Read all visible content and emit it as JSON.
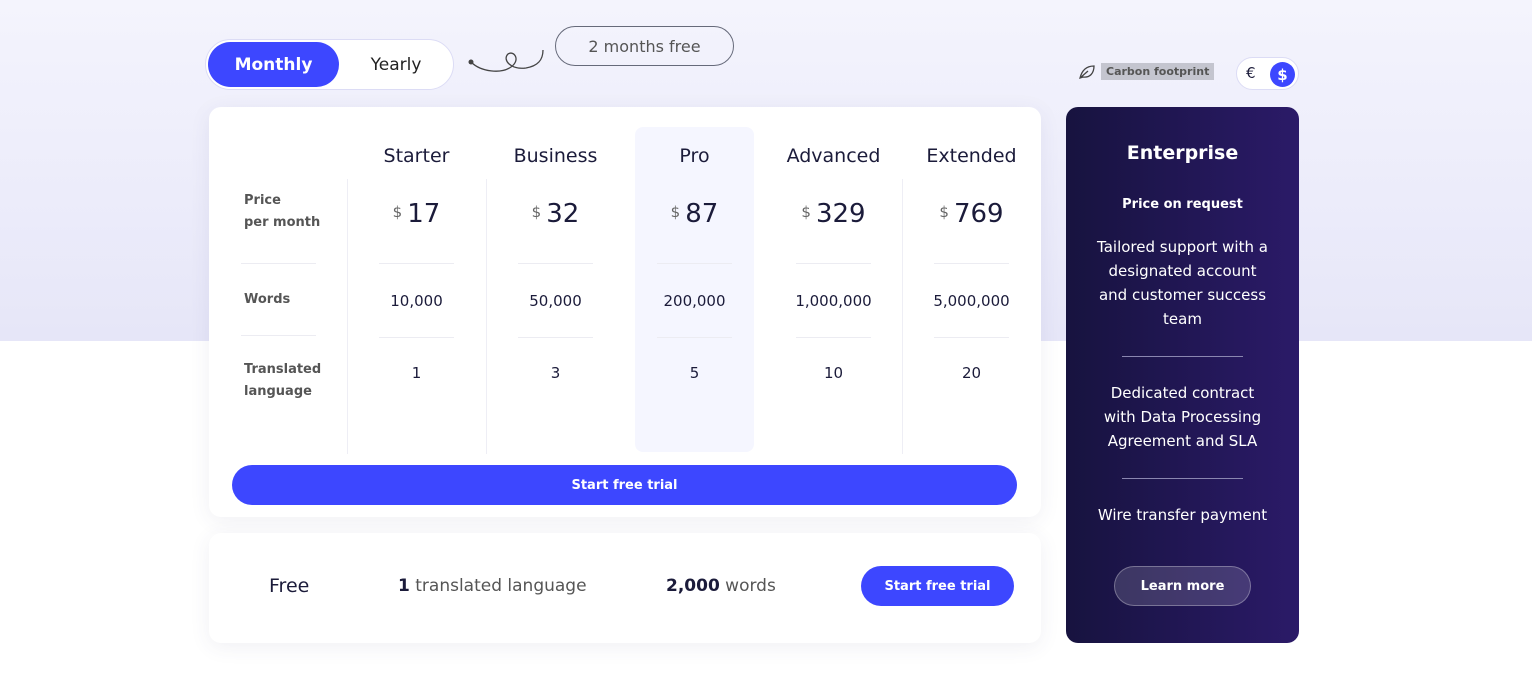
{
  "billing_toggle": {
    "monthly": "Monthly",
    "yearly": "Yearly",
    "selected": "Monthly"
  },
  "promo": "2 months free",
  "carbon": {
    "icon": "leaf-icon",
    "label": "Carbon footprint"
  },
  "currency": {
    "euro": "€",
    "dollar": "$",
    "selected": "$"
  },
  "table": {
    "labels": {
      "price": [
        "Price",
        "per month"
      ],
      "words": "Words",
      "languages": [
        "Translated",
        "language"
      ]
    },
    "plans": [
      {
        "name": "Starter",
        "currency": "$",
        "price": "17",
        "words": "10,000",
        "languages": "1"
      },
      {
        "name": "Business",
        "currency": "$",
        "price": "32",
        "words": "50,000",
        "languages": "3"
      },
      {
        "name": "Pro",
        "currency": "$",
        "price": "87",
        "words": "200,000",
        "languages": "5"
      },
      {
        "name": "Advanced",
        "currency": "$",
        "price": "329",
        "words": "1,000,000",
        "languages": "10"
      },
      {
        "name": "Extended",
        "currency": "$",
        "price": "769",
        "words": "5,000,000",
        "languages": "20"
      }
    ],
    "highlighted": "Pro",
    "cta": "Start free trial"
  },
  "free": {
    "title": "Free",
    "languages_num": "1",
    "languages_text": " translated language",
    "words_num": "2,000",
    "words_text": " words",
    "cta": "Start free trial"
  },
  "enterprise": {
    "title": "Enterprise",
    "price": "Price on request",
    "features": [
      "Tailored support with a designated account and customer success team",
      "Dedicated contract with Data Processing Agreement and SLA",
      "Wire transfer payment"
    ],
    "cta": "Learn more"
  },
  "colors": {
    "accent": "#3d47ff",
    "enterprise_bg": "#1f1650"
  }
}
